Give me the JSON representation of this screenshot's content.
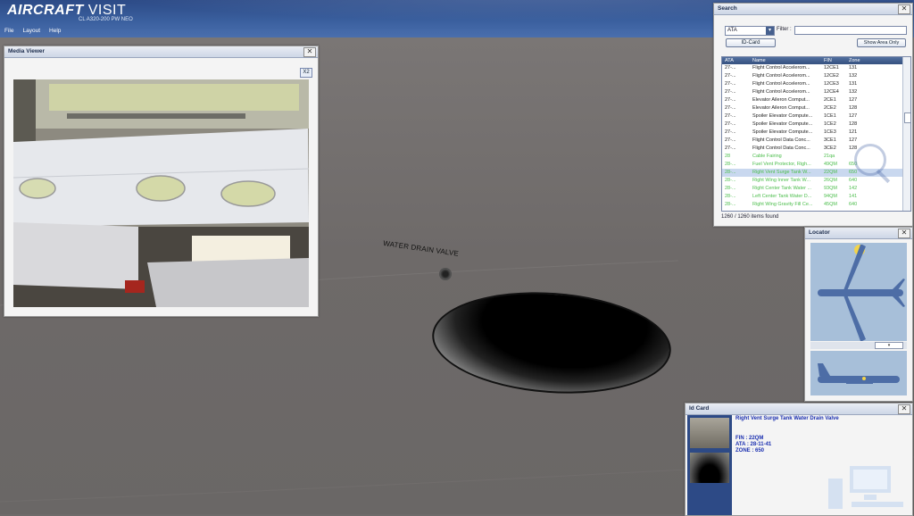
{
  "header": {
    "logo_prefix": "AIRCRAFT",
    "logo_suffix": "VISIT",
    "subtitle": "CL A320-200 PW NEO",
    "menu": [
      "File",
      "Layout",
      "Help"
    ]
  },
  "scene": {
    "annotation": "WATER DRAIN VALVE"
  },
  "media_viewer": {
    "title": "Media Viewer",
    "zoom_button": "X2"
  },
  "search": {
    "title": "Search",
    "ata_select": "ATA",
    "filter_label": "Filter :",
    "filter_value": "",
    "id_card_button": "ID-Card",
    "show_area_button": "Show Area Only",
    "columns": [
      "ATA",
      "Name",
      "FIN",
      "Zone"
    ],
    "rows": [
      {
        "ata": "27-...",
        "name": "Flight Control Accelerom...",
        "fin": "12CE1",
        "zone": "131",
        "green": false
      },
      {
        "ata": "27-...",
        "name": "Flight Control Accelerom...",
        "fin": "12CE2",
        "zone": "132",
        "green": false
      },
      {
        "ata": "27-...",
        "name": "Flight Control Accelerom...",
        "fin": "12CE3",
        "zone": "131",
        "green": false
      },
      {
        "ata": "27-...",
        "name": "Flight Control Accelerom...",
        "fin": "12CE4",
        "zone": "132",
        "green": false
      },
      {
        "ata": "27-...",
        "name": "Elevator Aileron Comput...",
        "fin": "2CE1",
        "zone": "127",
        "green": false
      },
      {
        "ata": "27-...",
        "name": "Elevator Aileron Comput...",
        "fin": "2CE2",
        "zone": "128",
        "green": false
      },
      {
        "ata": "27-...",
        "name": "Spoiler Elevator Compute...",
        "fin": "1CE1",
        "zone": "127",
        "green": false
      },
      {
        "ata": "27-...",
        "name": "Spoiler Elevator Compute...",
        "fin": "1CE2",
        "zone": "128",
        "green": false
      },
      {
        "ata": "27-...",
        "name": "Spoiler Elevator Compute...",
        "fin": "1CE3",
        "zone": "121",
        "green": false
      },
      {
        "ata": "27-...",
        "name": "Flight Control Data Conc...",
        "fin": "3CE1",
        "zone": "127",
        "green": false
      },
      {
        "ata": "27-...",
        "name": "Flight Control Data Conc...",
        "fin": "3CE2",
        "zone": "128",
        "green": false
      },
      {
        "ata": "28",
        "name": "Cable Fairing",
        "fin": "21qa",
        "zone": "",
        "green": true
      },
      {
        "ata": "28-...",
        "name": "Fuel Vent Protector, Righ...",
        "fin": "49QM",
        "zone": "650",
        "green": true
      },
      {
        "ata": "28-...",
        "name": "Right Vent Surge Tank W...",
        "fin": "22QM",
        "zone": "650",
        "green": true,
        "selected": true
      },
      {
        "ata": "28-...",
        "name": "Right Wing Inner Tank W...",
        "fin": "26QM",
        "zone": "640",
        "green": true
      },
      {
        "ata": "28-...",
        "name": "Right Center Tank Water ...",
        "fin": "93QM",
        "zone": "142",
        "green": true
      },
      {
        "ata": "28-...",
        "name": "Left Center Tank Water D...",
        "fin": "94QM",
        "zone": "141",
        "green": true
      },
      {
        "ata": "28-...",
        "name": "Right Wing Gravity Fill Ce...",
        "fin": "45QM",
        "zone": "640",
        "green": true
      }
    ],
    "count": "1260 / 1260 items found"
  },
  "locator": {
    "title": "Locator"
  },
  "id_card": {
    "title": "Id Card",
    "item_title": "Right Vent Surge Tank Water Drain Valve",
    "fin": "FIN : 22QM",
    "ata": "ATA : 28-11-41",
    "zone": "ZONE : 650"
  },
  "colors": {
    "header_blue": "#2c4a86",
    "list_green": "#4bbd4b",
    "card_text_blue": "#1a2fb0"
  }
}
